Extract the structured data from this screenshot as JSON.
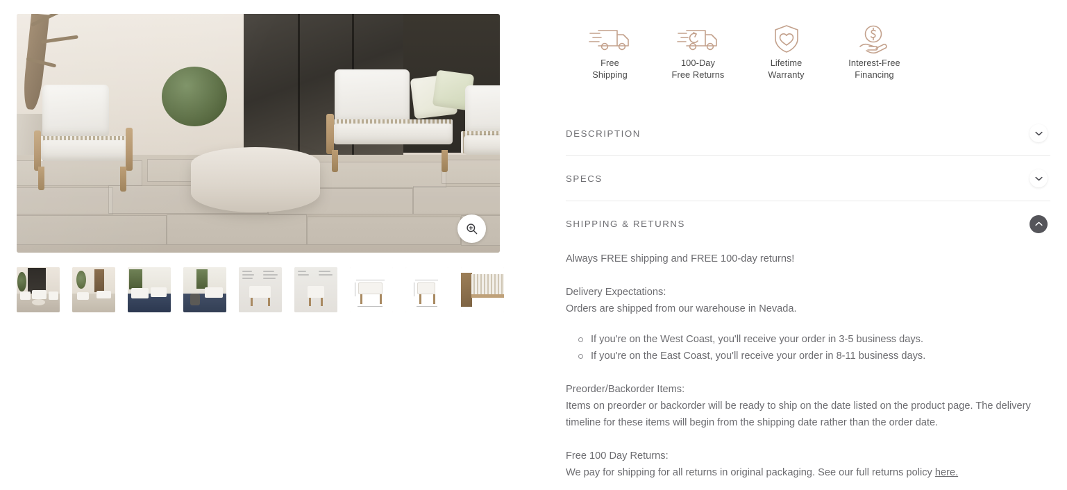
{
  "gallery": {
    "main_image_alt": "Outdoor teak lounge set with white cushions on stone patio",
    "zoom_button_icon": "zoom-in-icon",
    "selected_thumbnail_index": 0,
    "thumbnails": [
      {
        "alt": "Patio seating set in front of dark entry door",
        "kind": "lifestyle-entry"
      },
      {
        "alt": "Lounge set on travertine patio with olive tree",
        "kind": "lifestyle-olive"
      },
      {
        "alt": "Poolside lounge set with navy rug",
        "kind": "lifestyle-pool"
      },
      {
        "alt": "Covered porch seating with side table",
        "kind": "lifestyle-porch"
      },
      {
        "alt": "Loveseat feature callouts diagram",
        "kind": "features-loveseat"
      },
      {
        "alt": "Lounge chair feature callouts diagram",
        "kind": "features-chair"
      },
      {
        "alt": "Loveseat dimension drawing",
        "kind": "dimensions-loveseat"
      },
      {
        "alt": "Lounge chair dimension drawing",
        "kind": "dimensions-chair"
      },
      {
        "alt": "Close-up of woven rope back detail",
        "kind": "detail-rope"
      }
    ]
  },
  "trust_badges": [
    {
      "icon": "delivery-truck-icon",
      "line1": "Free",
      "line2": "Shipping"
    },
    {
      "icon": "return-truck-icon",
      "line1": "100-Day",
      "line2": "Free Returns"
    },
    {
      "icon": "shield-heart-icon",
      "line1": "Lifetime",
      "line2": "Warranty"
    },
    {
      "icon": "hand-coin-icon",
      "line1": "Interest-Free",
      "line2": "Financing"
    }
  ],
  "accordion": {
    "sections": [
      {
        "title": "Description",
        "expanded": false,
        "toggle_icon": "chevron-down-icon"
      },
      {
        "title": "Specs",
        "expanded": false,
        "toggle_icon": "chevron-down-icon"
      },
      {
        "title": "Shipping & Returns",
        "expanded": true,
        "toggle_icon": "chevron-up-icon"
      }
    ]
  },
  "shipping_returns": {
    "intro": "Always FREE shipping and FREE 100-day returns!",
    "delivery_heading": "Delivery Expectations:",
    "delivery_text": "Orders are shipped from our warehouse in Nevada.",
    "delivery_bullets": [
      "If you're on the West Coast, you'll receive your order in 3-5 business days.",
      "If you're on the East Coast, you'll receive your order in 8-11 business days."
    ],
    "preorder_heading": "Preorder/Backorder Items:",
    "preorder_text": "Items on preorder or backorder will be ready to ship on the date listed on the product page. The delivery timeline for these items will begin from the shipping date rather than the order date.",
    "returns_heading": "Free 100 Day Returns:",
    "returns_text_before": "We pay for shipping for all returns in original packaging. See our full returns policy ",
    "returns_link": "here.",
    "returns_text_after": ""
  },
  "colors": {
    "badge_icon": "#c3a18c",
    "heading_text": "#6f6f73",
    "body_text": "#6c6c70",
    "divider": "#e8e8e8",
    "toggle_active_bg": "#55555a",
    "thumb_selected_bar": "#55555a"
  }
}
